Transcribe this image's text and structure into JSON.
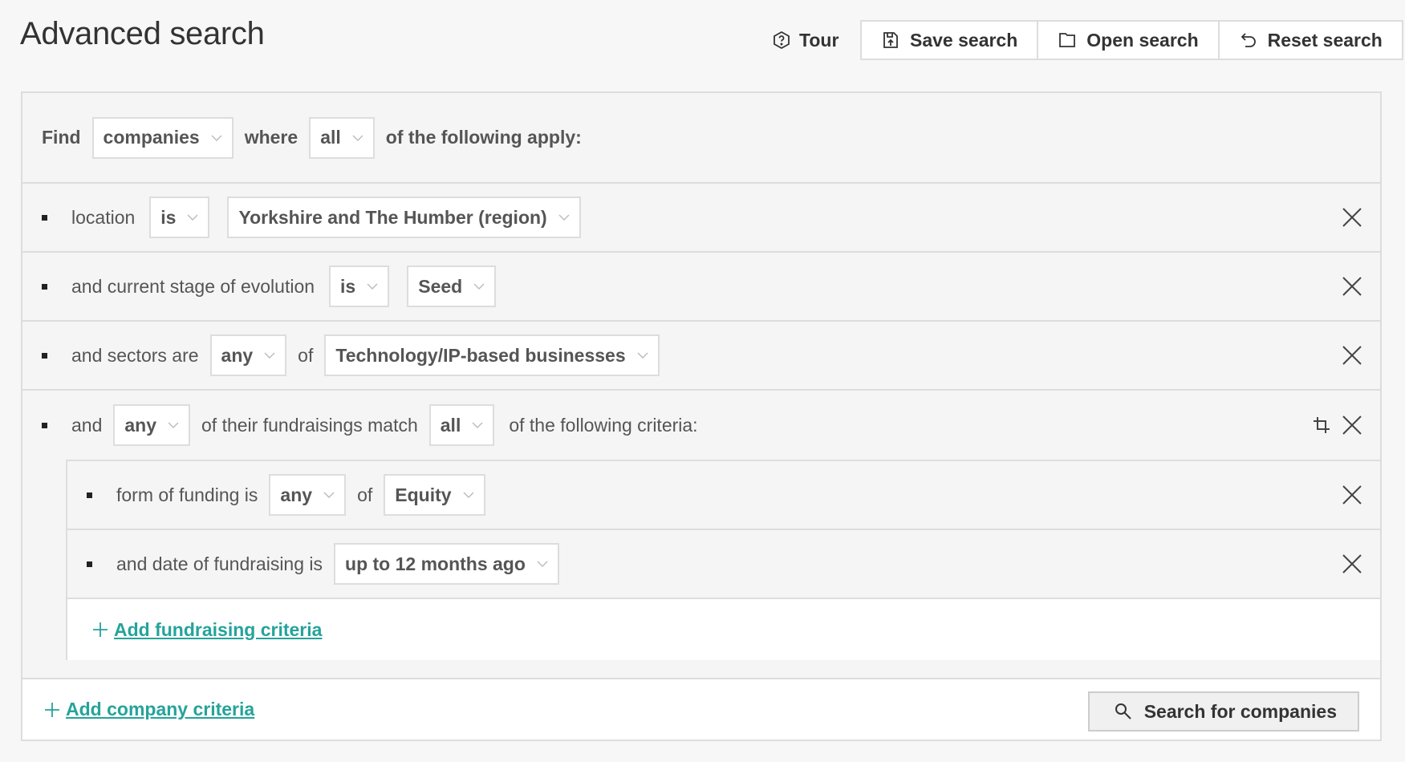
{
  "header": {
    "title": "Advanced search",
    "tour_label": "Tour",
    "save_label": "Save search",
    "open_label": "Open search",
    "reset_label": "Reset search"
  },
  "query": {
    "find_label": "Find",
    "entity": "companies",
    "where_label": "where",
    "match": "all",
    "suffix": "of the following apply:"
  },
  "criteria": [
    {
      "label": "location",
      "operator": "is",
      "value": "Yorkshire and The Humber (region)"
    },
    {
      "label": "and current stage of evolution",
      "operator": "is",
      "value": "Seed"
    },
    {
      "label": "and sectors are",
      "quantifier": "any",
      "of_label": "of",
      "value": "Technology/IP-based businesses"
    },
    {
      "and_label": "and",
      "quantifier": "any",
      "mid_label": "of their fundraisings match",
      "match": "all",
      "suffix": "of the following criteria:"
    }
  ],
  "fundraising_criteria": [
    {
      "label": "form of funding is",
      "quantifier": "any",
      "of_label": "of",
      "value": "Equity"
    },
    {
      "label": "and date of fundraising is",
      "value": "up to 12 months ago"
    }
  ],
  "links": {
    "add_fundraising": "Add fundraising criteria",
    "add_company": "Add company criteria"
  },
  "search_button": "Search for companies",
  "colors": {
    "accent": "#25a39a",
    "border": "#dddddd",
    "background": "#f7f7f7"
  }
}
